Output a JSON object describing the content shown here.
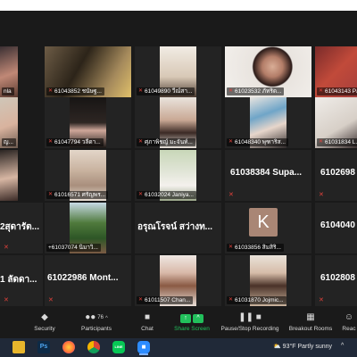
{
  "gallery": {
    "row1": {
      "t0": "nla",
      "t1": "61043852 ชนัษฐ...",
      "t2": "61049890 วีณ์สา...",
      "t3": "61023532 ภัทริด...",
      "t4": "61043143 Pat..."
    },
    "row2": {
      "t0": "ญ...",
      "t1": "61047794 วลีดา...",
      "t2": "ศุภาพิชญ์ มะจันท์...",
      "t3": "61048340 พุฑาริส...",
      "t4": "61031834 L..."
    },
    "row3": {
      "t0": "",
      "t1": "61016571 ศรัญพร...",
      "t2": "61032024 Janiya...",
      "t3": "61038384  Supa...",
      "t4": "6102698..."
    },
    "row4": {
      "t0": "2สุดารัต...",
      "t1": "+61037074 นิมาวิ...",
      "t2": "อรุณโรจน์ สว่างท...",
      "t3": "61033856 สิมสิริ...",
      "t3_avatar": "K",
      "t4": "6104040..."
    },
    "row5": {
      "t0": "1 ลัดดา...",
      "t1": "61022986  Mont...",
      "t2": "61011507 Chan...",
      "t3": "61031870 Jojmic...",
      "t4": "6102808..."
    }
  },
  "toolbar": {
    "security": "Security",
    "participants": "Participants",
    "participants_count": "76",
    "chat": "Chat",
    "share_screen": "Share Screen",
    "recording": "Pause/Stop Recording",
    "breakout": "Breakout Rooms",
    "reactions": "Reac",
    "share_color": "#22c05c"
  },
  "taskbar": {
    "weather": "93°F  Partly sunny",
    "photoshop": "Ps",
    "line": "LINE"
  }
}
